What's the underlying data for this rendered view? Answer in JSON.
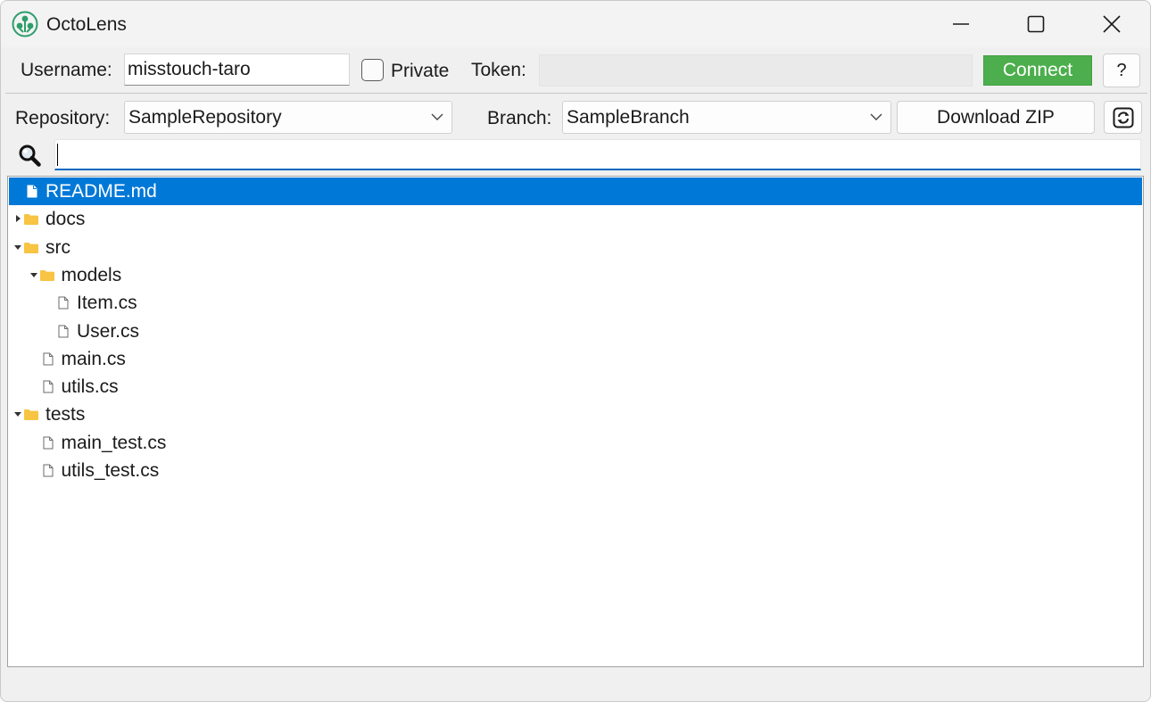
{
  "window": {
    "title": "OctoLens",
    "controls": {
      "minimize": "minimize-icon",
      "maximize": "maximize-icon",
      "close": "close-icon"
    }
  },
  "auth": {
    "username_label": "Username:",
    "username_value": "misstouch-taro",
    "private_label": "Private",
    "private_checked": false,
    "token_label": "Token:",
    "token_value": "",
    "connect_label": "Connect",
    "help_label": "?"
  },
  "repo": {
    "repository_label": "Repository:",
    "repository_value": "SampleRepository",
    "branch_label": "Branch:",
    "branch_value": "SampleBranch",
    "download_label": "Download ZIP",
    "refresh_icon": "refresh-icon"
  },
  "search": {
    "icon": "magnifier-icon",
    "value": ""
  },
  "tree": {
    "nodes": [
      {
        "label": "README.md",
        "type": "file",
        "depth": 0,
        "selected": true
      },
      {
        "label": "docs",
        "type": "folder",
        "depth": 0,
        "expanded": false
      },
      {
        "label": "src",
        "type": "folder",
        "depth": 0,
        "expanded": true
      },
      {
        "label": "models",
        "type": "folder",
        "depth": 1,
        "expanded": true
      },
      {
        "label": "Item.cs",
        "type": "file",
        "depth": 2
      },
      {
        "label": "User.cs",
        "type": "file",
        "depth": 2
      },
      {
        "label": "main.cs",
        "type": "file",
        "depth": 1
      },
      {
        "label": "utils.cs",
        "type": "file",
        "depth": 1
      },
      {
        "label": "tests",
        "type": "folder",
        "depth": 0,
        "expanded": true
      },
      {
        "label": "main_test.cs",
        "type": "file",
        "depth": 1
      },
      {
        "label": "utils_test.cs",
        "type": "file",
        "depth": 1
      }
    ]
  },
  "colors": {
    "accent": "#0078d7",
    "connect": "#4cae4c",
    "folder": "#f7c443",
    "app_icon": "#2e9e6a"
  }
}
